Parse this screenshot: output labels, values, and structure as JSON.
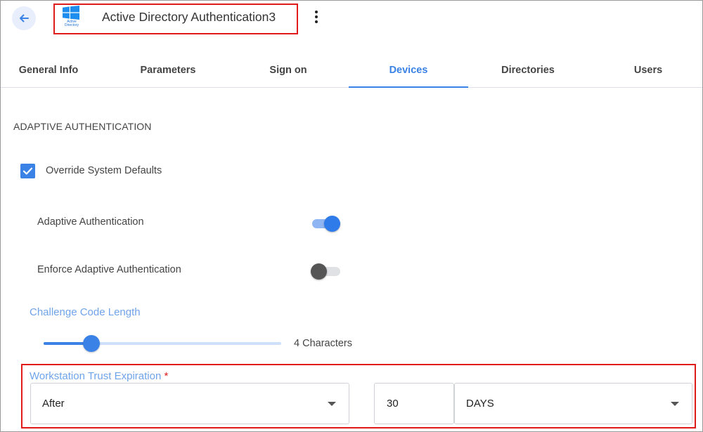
{
  "header": {
    "title": "Active Directory Authentication3",
    "logo_caption": "Active Directory",
    "back_icon": "arrow-left-icon",
    "menu_icon": "more-vertical-icon"
  },
  "tabs": [
    {
      "label": "General Info",
      "active": false
    },
    {
      "label": "Parameters",
      "active": false
    },
    {
      "label": "Sign on",
      "active": false
    },
    {
      "label": "Devices",
      "active": true
    },
    {
      "label": "Directories",
      "active": false
    },
    {
      "label": "Users",
      "active": false
    }
  ],
  "section": {
    "title": "ADAPTIVE AUTHENTICATION",
    "override": {
      "label": "Override System Defaults",
      "checked": true
    },
    "adaptive_auth": {
      "label": "Adaptive Authentication",
      "enabled": true
    },
    "enforce_adaptive_auth": {
      "label": "Enforce Adaptive Authentication",
      "enabled": false
    },
    "challenge_code": {
      "label": "Challenge Code Length",
      "value_text": "4 Characters",
      "fraction": 0.2
    },
    "trust_expiration": {
      "label": "Workstation Trust Expiration",
      "required_mark": "*",
      "mode": "After",
      "amount": "30",
      "unit": "DAYS"
    }
  },
  "colors": {
    "accent": "#3b82e6",
    "highlight": "#e01b1b",
    "label_blue": "#6fa3ea"
  }
}
